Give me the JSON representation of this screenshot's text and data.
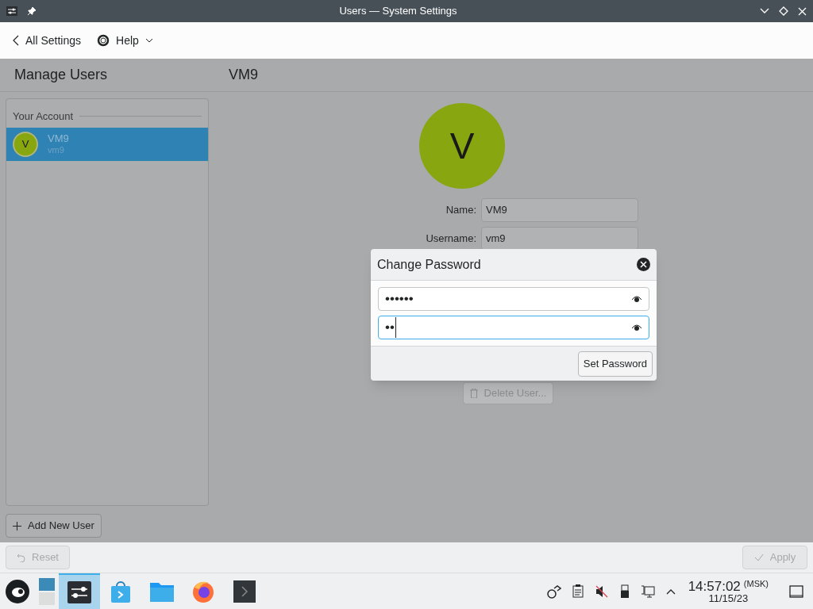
{
  "window": {
    "title": "Users — System Settings"
  },
  "toolbar": {
    "back": "All Settings",
    "help": "Help"
  },
  "header": {
    "left_title": "Manage Users",
    "right_title": "VM9"
  },
  "sidebar": {
    "section": "Your Account",
    "users": [
      {
        "initial": "V",
        "name": "VM9",
        "username": "vm9",
        "selected": true
      }
    ],
    "add_button": "Add New User"
  },
  "profile": {
    "initial": "V",
    "fields": [
      {
        "label": "Name:",
        "value": "VM9"
      },
      {
        "label": "Username:",
        "value": "vm9"
      }
    ],
    "delete_button": "Delete User..."
  },
  "dialog": {
    "title": "Change Password",
    "fields": [
      {
        "value": "••••••",
        "focused": false
      },
      {
        "value": "••",
        "focused": true
      }
    ],
    "button": "Set Password"
  },
  "footer": {
    "reset": {
      "label": "Reset",
      "disabled": true
    },
    "apply": {
      "label": "Apply",
      "disabled": true
    }
  },
  "taskbar": {
    "tasks": [
      {
        "kind": "desktop",
        "selected": false
      },
      {
        "kind": "settings",
        "selected": true
      },
      {
        "kind": "store",
        "selected": false
      },
      {
        "kind": "files",
        "selected": false
      },
      {
        "kind": "browser",
        "selected": false
      },
      {
        "kind": "terminal",
        "selected": false
      }
    ],
    "clock": {
      "time": "14:57:02",
      "zone": "(MSK)",
      "date": "11/15/23"
    }
  }
}
